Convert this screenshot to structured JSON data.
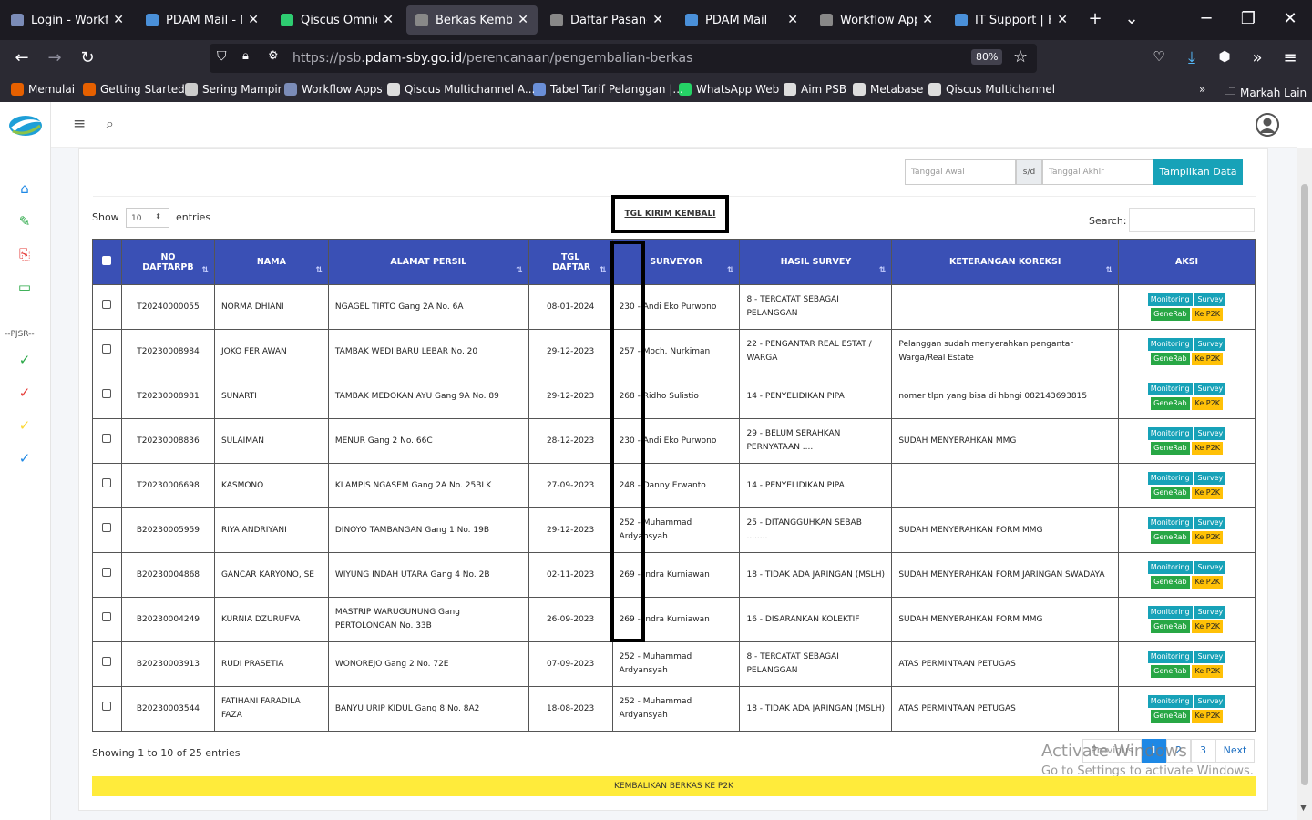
{
  "browser": {
    "tabs": [
      {
        "label": "Login - Workflow",
        "color": "#7b8cb8"
      },
      {
        "label": "PDAM Mail - Ma",
        "color": "#4a90d9"
      },
      {
        "label": "Qiscus Omnichan",
        "color": "#2ecc71"
      },
      {
        "label": "Berkas Kembali | PDA",
        "color": "#888"
      },
      {
        "label": "Daftar Pasang Baru | I",
        "color": "#888"
      },
      {
        "label": "PDAM Mail",
        "color": "#4a90d9"
      },
      {
        "label": "Workflow Apps",
        "color": "#888"
      },
      {
        "label": "IT Support | Form",
        "color": "#4a90d9"
      }
    ],
    "url_prefix": "https://psb.",
    "url_domain": "pdam-sby.go.id",
    "url_path": "/perencanaan/pengembalian-berkas",
    "zoom": "80%",
    "bookmarks": [
      "Memulai",
      "Getting Started",
      "Sering Mampir",
      "Workflow Apps",
      "Qiscus Multichannel A...",
      "Tabel Tarif Pelanggan |...",
      "WhatsApp Web",
      "Aim PSB",
      "Metabase",
      "Qiscus Multichannel"
    ],
    "other_bookmarks": "Markah Lain"
  },
  "sidebar": {
    "section_label": "--PJSR--"
  },
  "filter": {
    "start_placeholder": "Tanggal Awal",
    "sep": "s/d",
    "end_placeholder": "Tanggal Akhir",
    "button": "Tampilkan Data"
  },
  "annotation_label": "TGL KIRIM KEMBALI",
  "length": {
    "show": "Show",
    "value": "10",
    "entries": "entries"
  },
  "search_label": "Search:",
  "headers": [
    "NO DAFTARPB",
    "NAMA",
    "ALAMAT PERSIL",
    "TGL DAFTAR",
    "SURVEYOR",
    "HASIL SURVEY",
    "KETERANGAN KOREKSI",
    "AKSI"
  ],
  "rows": [
    {
      "no": "T20240000055",
      "nama": "NORMA DHIANI",
      "alamat": "NGAGEL TIRTO Gang 2A No. 6A",
      "tgl": "08-01-2024",
      "surveyor": "230 - Andi Eko Purwono",
      "hasil": "8 - TERCATAT SEBAGAI PELANGGAN",
      "ket": ""
    },
    {
      "no": "T20230008984",
      "nama": "JOKO FERIAWAN",
      "alamat": "TAMBAK WEDI BARU LEBAR No. 20",
      "tgl": "29-12-2023",
      "surveyor": "257 - Moch. Nurkiman",
      "hasil": "22 - PENGANTAR REAL ESTAT / WARGA",
      "ket": "Pelanggan sudah menyerahkan pengantar Warga/Real Estate"
    },
    {
      "no": "T20230008981",
      "nama": "SUNARTI",
      "alamat": "TAMBAK MEDOKAN AYU Gang 9A No. 89",
      "tgl": "29-12-2023",
      "surveyor": "268 - Ridho Sulistio",
      "hasil": "14 - PENYELIDIKAN PIPA",
      "ket": "nomer tlpn yang bisa di hbngi 082143693815"
    },
    {
      "no": "T20230008836",
      "nama": "SULAIMAN",
      "alamat": "MENUR Gang 2 No. 66C",
      "tgl": "28-12-2023",
      "surveyor": "230 - Andi Eko Purwono",
      "hasil": "29 - BELUM SERAHKAN PERNYATAAN ....",
      "ket": "SUDAH MENYERAHKAN MMG"
    },
    {
      "no": "T20230006698",
      "nama": "KASMONO",
      "alamat": "KLAMPIS NGASEM Gang 2A No. 25BLK",
      "tgl": "27-09-2023",
      "surveyor": "248 - Danny Erwanto",
      "hasil": "14 - PENYELIDIKAN PIPA",
      "ket": ""
    },
    {
      "no": "B20230005959",
      "nama": "RIYA ANDRIYANI",
      "alamat": "DINOYO TAMBANGAN Gang 1 No. 19B",
      "tgl": "29-12-2023",
      "surveyor": "252 - Muhammad Ardyansyah",
      "hasil": "25 - DITANGGUHKAN SEBAB ........",
      "ket": "SUDAH MENYERAHKAN FORM MMG"
    },
    {
      "no": "B20230004868",
      "nama": "GANCAR KARYONO, SE",
      "alamat": "WIYUNG INDAH UTARA Gang 4 No. 2B",
      "tgl": "02-11-2023",
      "surveyor": "269 - Indra Kurniawan",
      "hasil": "18 - TIDAK ADA JARINGAN (MSLH)",
      "ket": "SUDAH MENYERAHKAN FORM JARINGAN SWADAYA"
    },
    {
      "no": "B20230004249",
      "nama": "KURNIA DZURUFVA",
      "alamat": "MASTRIP WARUGUNUNG Gang PERTOLONGAN No. 33B",
      "tgl": "26-09-2023",
      "surveyor": "269 - Indra Kurniawan",
      "hasil": "16 - DISARANKAN KOLEKTIF",
      "ket": "SUDAH MENYERAHKAN FORM MMG"
    },
    {
      "no": "B20230003913",
      "nama": "RUDI PRASETIA",
      "alamat": "WONOREJO Gang 2 No. 72E",
      "tgl": "07-09-2023",
      "surveyor": "252 - Muhammad Ardyansyah",
      "hasil": "8 - TERCATAT SEBAGAI PELANGGAN",
      "ket": "ATAS PERMINTAAN PETUGAS"
    },
    {
      "no": "B20230003544",
      "nama": "FATIHANI FARADILA FAZA",
      "alamat": "BANYU URIP KIDUL Gang 8 No. 8A2",
      "tgl": "18-08-2023",
      "surveyor": "252 - Muhammad Ardyansyah",
      "hasil": "18 - TIDAK ADA JARINGAN (MSLH)",
      "ket": "ATAS PERMINTAAN PETUGAS"
    }
  ],
  "actions": {
    "monitoring": "Monitoring",
    "survey": "Survey",
    "generab": "GeneRab",
    "kep2k": "Ke P2K"
  },
  "info": "Showing 1 to 10 of 25 entries",
  "pagination": {
    "prev": "Previous",
    "pages": [
      "1",
      "2",
      "3"
    ],
    "next": "Next"
  },
  "watermark": {
    "line1": "Activate Windows",
    "line2": "Go to Settings to activate Windows."
  },
  "return_button": "KEMBALIKAN BERKAS KE P2K"
}
